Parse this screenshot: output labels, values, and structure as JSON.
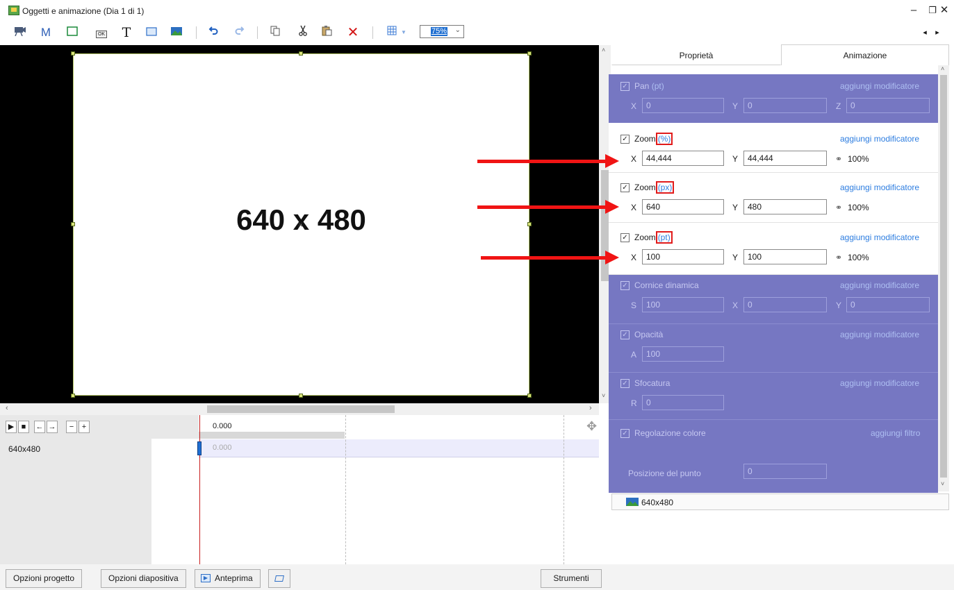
{
  "window": {
    "title": "Oggetti e animazione (Dia 1 di 1)",
    "min": "–",
    "max": "❐",
    "close": "✕"
  },
  "toolbar": {
    "m_label": "M",
    "t_label": "T",
    "ok_label": "OK",
    "zoom_value": "75%",
    "nav_prev": "◂",
    "nav_next": "▸",
    "icons": [
      "camera-icon",
      "mask-icon",
      "frame-icon",
      "button-icon",
      "text-icon",
      "rectangle-icon",
      "image-icon",
      "undo-icon",
      "redo-icon",
      "copy-icon",
      "cut-icon",
      "paste-icon",
      "delete-icon",
      "grid-icon"
    ]
  },
  "canvas": {
    "slide_text": "640 x 480"
  },
  "timeline": {
    "ruler_time": "0.000",
    "track_label": "640x480",
    "track_time": "0.000",
    "buttons": [
      "▶",
      "■",
      "←",
      "→",
      "−",
      "+"
    ]
  },
  "bottom": {
    "project_options": "Opzioni progetto",
    "slide_options": "Opzioni diapositiva",
    "preview": "Anteprima",
    "tools": "Strumenti"
  },
  "tabs": {
    "properties": "Proprietà",
    "animation": "Animazione"
  },
  "panel": {
    "add_modifier": "aggiungi modificatore",
    "add_filter": "aggiungi filtro",
    "pan": {
      "label": "Pan",
      "unit": "(pt)",
      "x_label": "X",
      "x": "0",
      "y_label": "Y",
      "y": "0",
      "z_label": "Z",
      "z": "0"
    },
    "zoom_pct": {
      "label": "Zoom",
      "unit": "(%)",
      "x_label": "X",
      "x": "44,444",
      "y_label": "Y",
      "y": "44,444",
      "link": "100%"
    },
    "zoom_px": {
      "label": "Zoom",
      "unit": "(px)",
      "x_label": "X",
      "x": "640",
      "y_label": "Y",
      "y": "480",
      "link": "100%"
    },
    "zoom_pt": {
      "label": "Zoom",
      "unit": "(pt)",
      "x_label": "X",
      "x": "100",
      "y_label": "Y",
      "y": "100",
      "link": "100%"
    },
    "dynamic_frame": {
      "label": "Cornice dinamica",
      "s_label": "S",
      "s": "100",
      "x_label": "X",
      "x": "0",
      "y_label": "Y",
      "y": "0"
    },
    "opacity": {
      "label": "Opacità",
      "a_label": "A",
      "a": "100"
    },
    "blur": {
      "label": "Sfocatura",
      "r_label": "R",
      "r": "0"
    },
    "color_adjust": {
      "label": "Regolazione colore"
    },
    "point_position": {
      "label": "Posizione del punto",
      "value": "0"
    }
  },
  "object_list": {
    "item": "640x480"
  },
  "colors": {
    "accent_red": "#f01414",
    "panel_purple": "#7677c2",
    "link_blue": "#2d7de0"
  }
}
